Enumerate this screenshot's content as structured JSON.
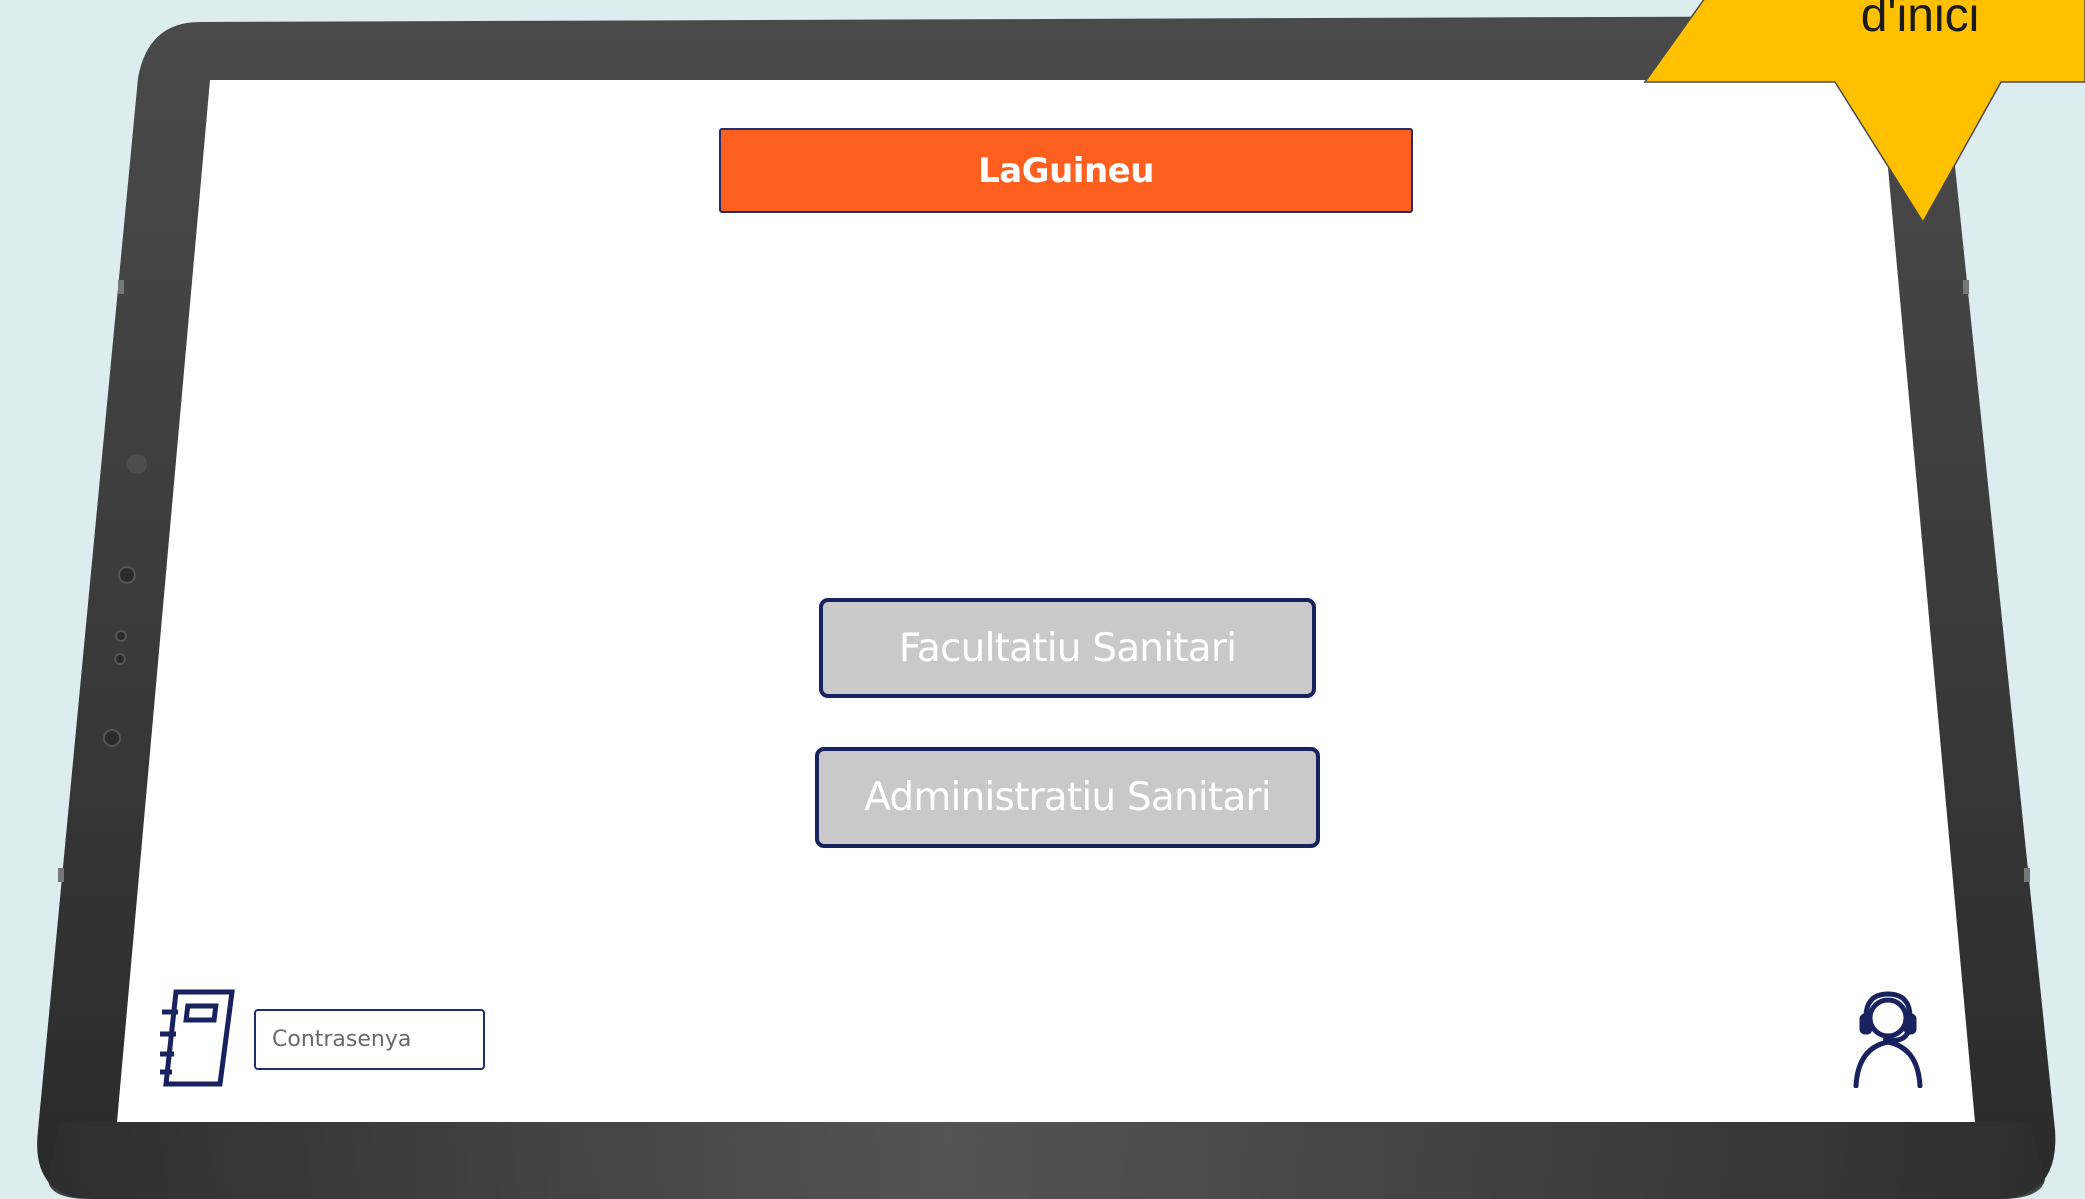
{
  "app": {
    "title": "LaGuineu"
  },
  "menu": {
    "facultatiu_label": "Facultatiu Sanitari",
    "administratiu_label": "Administratiu Sanitari"
  },
  "login": {
    "password_placeholder": "Contrasenya"
  },
  "annotation": {
    "callout_text": "d'inici"
  },
  "colors": {
    "background": "#dcecef",
    "title_bar": "#fd5f1e",
    "button_fill": "#c9c9c9",
    "border_navy": "#17225e",
    "callout_yellow": "#ffc000"
  },
  "icons": {
    "bottom_left": "notebook-icon",
    "bottom_right": "support-agent-icon"
  }
}
